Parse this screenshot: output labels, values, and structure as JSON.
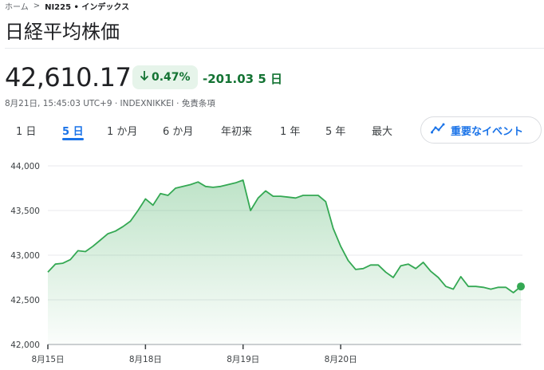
{
  "breadcrumb": {
    "home": "ホーム",
    "current": "NI225 • インデックス"
  },
  "title": "日経平均株価",
  "quote": {
    "price": "42,610.17",
    "change_pct": "0.47%",
    "change_abs": "-201.03 5 日",
    "meta": "8月21日, 15:45:03 UTC+9 · INDEXNIKKEI · 免責条項"
  },
  "tabs": [
    {
      "label": "1 日",
      "active": false
    },
    {
      "label": "5 日",
      "active": true
    },
    {
      "label": "1 か月",
      "active": false
    },
    {
      "label": "6 か月",
      "active": false
    },
    {
      "label": "年初来",
      "active": false
    },
    {
      "label": "1 年",
      "active": false
    },
    {
      "label": "5 年",
      "active": false
    },
    {
      "label": "最大",
      "active": false
    }
  ],
  "events_button": {
    "label": "重要なイベント",
    "icon": "trend-events-icon"
  },
  "colors": {
    "up_text": "#137333",
    "pill_bg": "#e6f4ea",
    "line": "#34a853",
    "accent": "#1a73e8"
  },
  "chart_data": {
    "type": "area",
    "y_ticks": [
      42000,
      42500,
      43000,
      43500,
      44000
    ],
    "y_tick_labels": [
      "42,000",
      "42,500",
      "43,000",
      "43,500",
      "44,000"
    ],
    "ylim": [
      42000,
      44000
    ],
    "grid": true,
    "x_labels": [
      "8月15日",
      "8月18日",
      "8月19日",
      "8月20日"
    ],
    "x_label_index": [
      0,
      13,
      26,
      39
    ],
    "values": [
      42810,
      42900,
      42910,
      42950,
      43050,
      43040,
      43100,
      43170,
      43240,
      43270,
      43320,
      43380,
      43500,
      43630,
      43560,
      43690,
      43670,
      43750,
      43770,
      43790,
      43820,
      43770,
      43760,
      43770,
      43790,
      43810,
      43840,
      43500,
      43640,
      43720,
      43660,
      43660,
      43650,
      43640,
      43670,
      43670,
      43670,
      43600,
      43300,
      43100,
      42940,
      42840,
      42850,
      42890,
      42890,
      42810,
      42750,
      42880,
      42900,
      42850,
      42920,
      42820,
      42750,
      42650,
      42620,
      42760,
      42650,
      42650,
      42640,
      42620,
      42640,
      42640,
      42580,
      42650
    ],
    "last_value": 42610.17
  }
}
